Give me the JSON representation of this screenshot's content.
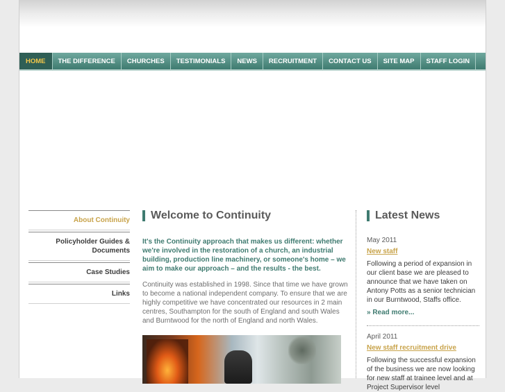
{
  "nav": {
    "items": [
      {
        "label": "HOME",
        "active": true
      },
      {
        "label": "THE DIFFERENCE",
        "active": false
      },
      {
        "label": "CHURCHES",
        "active": false
      },
      {
        "label": "TESTIMONIALS",
        "active": false
      },
      {
        "label": "NEWS",
        "active": false
      },
      {
        "label": "RECRUITMENT",
        "active": false
      },
      {
        "label": "CONTACT US",
        "active": false
      },
      {
        "label": "SITE MAP",
        "active": false
      },
      {
        "label": "STAFF LOGIN",
        "active": false
      }
    ]
  },
  "sidebar": {
    "items": [
      {
        "label": "About Continuity",
        "active": true
      },
      {
        "label": "Policyholder Guides & Documents",
        "active": false
      },
      {
        "label": "Case Studies",
        "active": false
      },
      {
        "label": "Links",
        "active": false
      }
    ]
  },
  "main": {
    "title": "Welcome to Continuity",
    "intro": "It's the Continuity approach that makes us different: whether we're involved in the restoration of a church, an industrial building, production line machinery, or someone's home – we aim to make our approach – and the results - the best.",
    "body": "Continuity was established in 1998. Since that time we have grown to become a national independent company. To ensure that we are highly competitive we have concentrated our resources in 2 main centres, Southampton for the south of England and south Wales and Burntwood for the north of England and north Wales."
  },
  "news": {
    "title": "Latest News",
    "entries": [
      {
        "date": "May 2011",
        "headline": "New staff",
        "body": "Following a period of expansion in our client base we are pleased to announce that we have taken on Antony Potts as a senior technician in our Burntwood, Staffs office.",
        "read_more": "» Read more..."
      },
      {
        "date": "April 2011",
        "headline": "New staff recruitment drive",
        "body": "Following the successful expansion of the business we are now looking for new staff at trainee level and at Project Supervisor level"
      }
    ]
  },
  "colors": {
    "accent": "#3f7b70",
    "highlight": "#c8a34a",
    "nav_active": "#2f5f56"
  }
}
